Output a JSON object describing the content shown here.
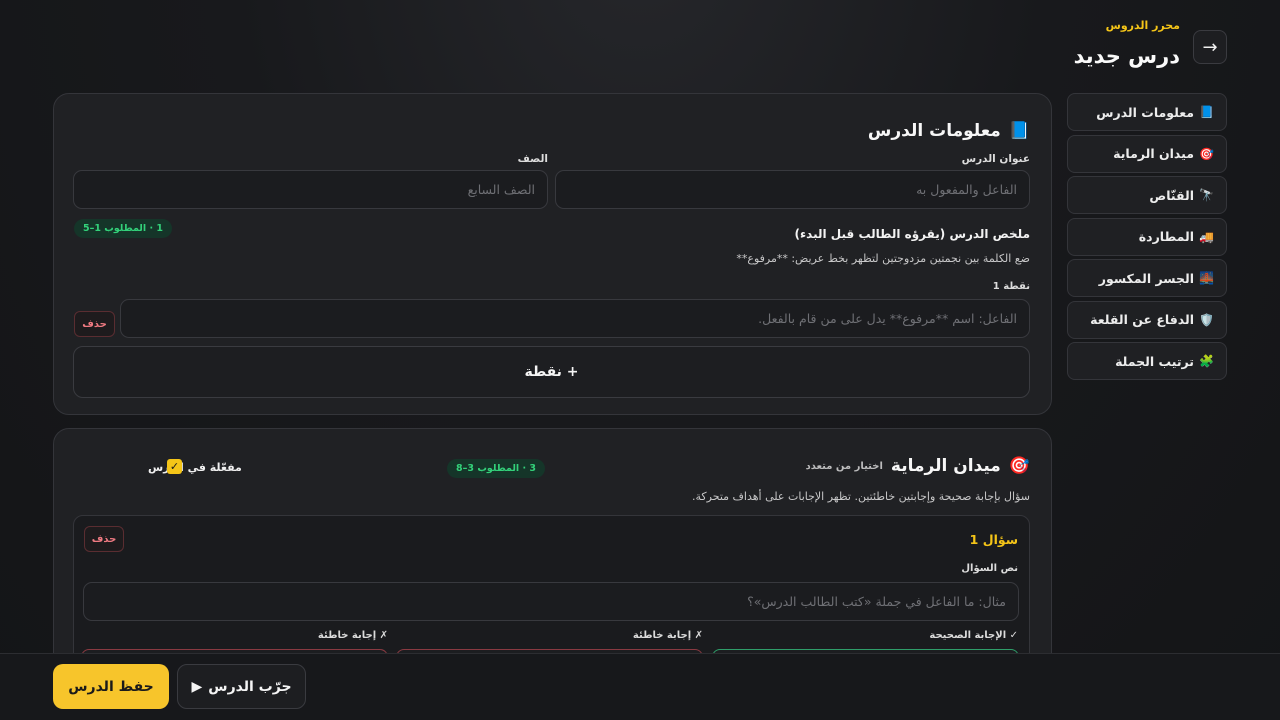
{
  "header": {
    "editor_label": "محرر الدروس",
    "title": "درس جديد",
    "back_icon": "→"
  },
  "sidebar": {
    "items": [
      {
        "icon": "📘",
        "label": "معلومات الدرس"
      },
      {
        "icon": "🎯",
        "label": "ميدان الرماية"
      },
      {
        "icon": "🔭",
        "label": "القنّاص"
      },
      {
        "icon": "🚚",
        "label": "المطاردة"
      },
      {
        "icon": "🌉",
        "label": "الجسر المكسور"
      },
      {
        "icon": "🛡️",
        "label": "الدفاع عن القلعة"
      },
      {
        "icon": "🧩",
        "label": "ترتيب الجملة"
      }
    ]
  },
  "lesson_info": {
    "icon": "📘",
    "title": "معلومات الدرس",
    "lesson_title_label": "عنوان الدرس",
    "lesson_title_placeholder": "الفاعل والمفعول به",
    "grade_label": "الصف",
    "grade_placeholder": "الصف السابع",
    "summary_label": "ملخص الدرس (يقرؤه الطالب قبل البدء)",
    "summary_badge": "1 · المطلوب 1–5",
    "summary_hint": "ضع الكلمة بين نجمتين مزدوجتين لتظهر بخط عريض: **مرفوع**",
    "point_label": "نقطة 1",
    "point_placeholder": "الفاعل: اسم **مرفوع** يدل على من قام بالفعل.",
    "delete_label": "حذف",
    "add_point_label": "+ نقطة"
  },
  "shooting_range": {
    "icon": "🎯",
    "title": "ميدان الرماية",
    "subtitle": "اختيار من متعدد",
    "badge": "3 · المطلوب 3–8",
    "enabled_label": "مفعّلة في الدرس",
    "enabled_check": "✓",
    "description": "سؤال بإجابة صحيحة وإجابتين خاطئتين. تظهر الإجابات على أهداف متحركة.",
    "question": {
      "title": "سؤال 1",
      "delete_label": "حذف",
      "text_label": "نص السؤال",
      "text_placeholder": "مثال: ما الفاعل في جملة «كتب الطالب الدرس»؟",
      "correct_label": "✓ الإجابة الصحيحة",
      "wrong_label_1": "✗ إجابة خاطئة",
      "wrong_label_2": "✗ إجابة خاطئة",
      "colors": {
        "correct": "#2f9e6a",
        "wrong": "#8a3a42"
      }
    }
  },
  "footer": {
    "save_label": "حفظ الدرس",
    "try_label": "جرّب الدرس",
    "play_icon": "▶"
  },
  "colors": {
    "accent": "#f7c52b",
    "badge_green": "#33d17a",
    "danger": "#ef7a82"
  }
}
